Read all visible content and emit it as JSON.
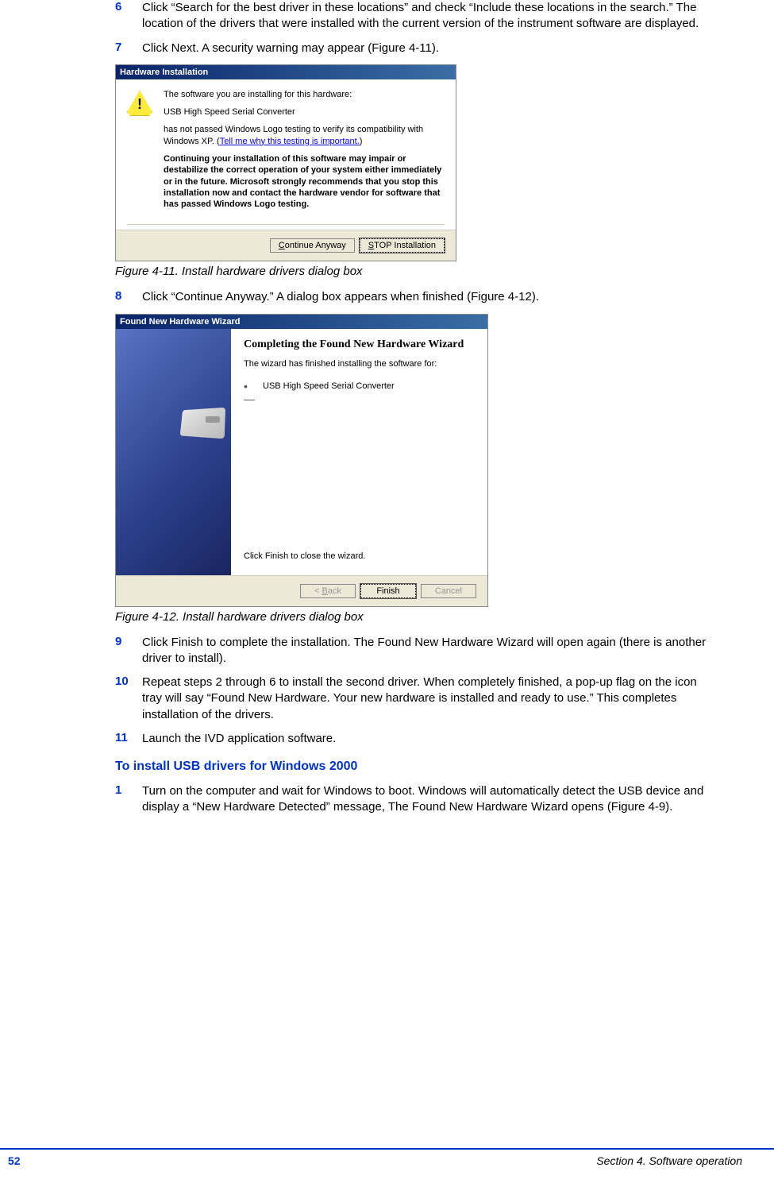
{
  "steps_a": [
    {
      "n": "6",
      "text": "Click “Search for the best driver in these locations” and check “Include these locations in the search.” The location of the drivers that were installed with the current version of the instrument software are displayed."
    },
    {
      "n": "7",
      "text": "Click Next. A security warning may appear (Figure 4-11)."
    }
  ],
  "dialog1": {
    "title": "Hardware Installation",
    "line1": "The software you are installing for this hardware:",
    "device": "USB High Speed Serial Converter",
    "line2a": "has not passed Windows Logo testing to verify its compatibility with Windows XP. (",
    "link": "Tell me why this testing is important.",
    "line2b": ")",
    "bold": "Continuing your installation of this software may impair or destabilize the correct operation of your system either immediately or in the future. Microsoft strongly recommends that you stop this installation now and contact the hardware vendor for software that has passed Windows Logo testing.",
    "btn_continue": "Continue Anyway",
    "btn_stop": "STOP Installation"
  },
  "fig1_caption": "Figure 4-11. Install hardware drivers dialog box",
  "step8": {
    "n": "8",
    "text": "Click “Continue Anyway.” A dialog box appears when finished (Figure 4-12)."
  },
  "dialog2": {
    "title": "Found New Hardware Wizard",
    "heading": "Completing the Found New Hardware Wizard",
    "sub": "The wizard has finished installing the software for:",
    "device": "USB High Speed Serial Converter",
    "close": "Click Finish to close the wizard.",
    "btn_back": "< Back",
    "btn_finish": "Finish",
    "btn_cancel": "Cancel"
  },
  "fig2_caption": "Figure 4-12. Install hardware drivers dialog box",
  "steps_b": [
    {
      "n": "9",
      "text": "Click Finish to complete the installation. The Found New Hardware Wizard will open again (there is another driver to install)."
    },
    {
      "n": "10",
      "text": "Repeat steps 2 through 6 to install the second driver. When completely finished, a pop-up flag on the icon tray will say “Found New Hardware. Your new hardware is installed and ready to use.” This completes installation of the drivers."
    },
    {
      "n": "11",
      "text": "Launch the IVD application software."
    }
  ],
  "section_heading": "To install USB drivers for Windows 2000",
  "steps_c": [
    {
      "n": "1",
      "text": "Turn on the computer and wait for Windows to boot. Windows will automatically detect the USB device and display a “New Hardware Detected” message, The Found New Hardware Wizard opens (Figure 4-9)."
    }
  ],
  "footer": {
    "page": "52",
    "section": "Section 4. Software operation"
  }
}
